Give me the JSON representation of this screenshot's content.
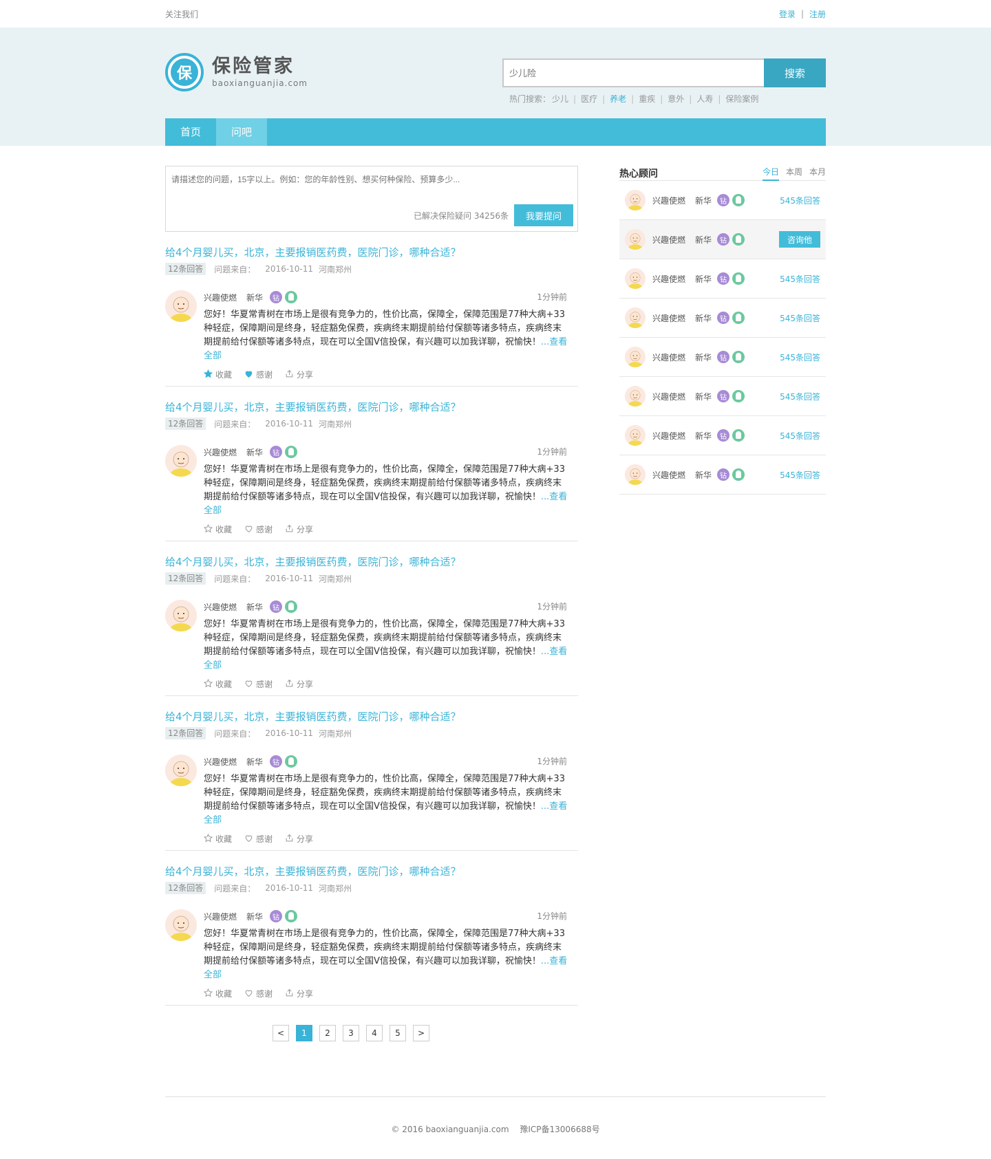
{
  "topbar": {
    "follow": "关注我们",
    "login": "登录",
    "register": "注册"
  },
  "logo": {
    "cn": "保险管家",
    "en": "baoxianguanjia.com",
    "mark": "保"
  },
  "search": {
    "placeholder": "少儿险",
    "button": "搜索",
    "hot_label": "热门搜索：",
    "hot_items": [
      "少儿",
      "医疗",
      "养老",
      "重疾",
      "意外",
      "人寿",
      "保险案例"
    ]
  },
  "nav": [
    "首页",
    "问吧"
  ],
  "ask": {
    "placeholder": "请描述您的问题，15字以上。例如：您的年龄性别、想买何种保险、预算多少...",
    "solved": "已解决保险疑问  34256条",
    "button": "我要提问"
  },
  "questions": [
    {
      "title": "给4个月婴儿买，北京，主要报销医药费，医院门诊，哪种合适？",
      "count": "12条回答",
      "from": "问题来自：",
      "date": "2016-10-11",
      "place": "河南郑州",
      "user": "兴趣使燃",
      "company": "新华",
      "vbadge": "钻",
      "time": "1分钟前",
      "text": "您好！华夏常青树在市场上是很有竞争力的，性价比高，保障全，保障范围是77种大病+33种轻症，保障期间是终身，轻症豁免保费，疾病终末期提前给付保额等诸多特点，疾病终末期提前给付保额等诸多特点，现在可以全国V信投保，有兴趣可以加我详聊，祝愉快！",
      "more": "...查看全部",
      "collect": "收藏",
      "thanks": "感谢",
      "share": "分享",
      "filled": true
    },
    {
      "title": "给4个月婴儿买，北京，主要报销医药费，医院门诊，哪种合适？",
      "count": "12条回答",
      "from": "问题来自：",
      "date": "2016-10-11",
      "place": "河南郑州",
      "user": "兴趣使燃",
      "company": "新华",
      "vbadge": "钻",
      "time": "1分钟前",
      "text": "您好！华夏常青树在市场上是很有竞争力的，性价比高，保障全，保障范围是77种大病+33种轻症，保障期间是终身，轻症豁免保费，疾病终末期提前给付保额等诸多特点，疾病终末期提前给付保额等诸多特点，现在可以全国V信投保，有兴趣可以加我详聊，祝愉快！",
      "more": "...查看全部",
      "collect": "收藏",
      "thanks": "感谢",
      "share": "分享",
      "filled": false
    },
    {
      "title": "给4个月婴儿买，北京，主要报销医药费，医院门诊，哪种合适？",
      "count": "12条回答",
      "from": "问题来自：",
      "date": "2016-10-11",
      "place": "河南郑州",
      "user": "兴趣使燃",
      "company": "新华",
      "vbadge": "钻",
      "time": "1分钟前",
      "text": "您好！华夏常青树在市场上是很有竞争力的，性价比高，保障全，保障范围是77种大病+33种轻症，保障期间是终身，轻症豁免保费，疾病终末期提前给付保额等诸多特点，疾病终末期提前给付保额等诸多特点，现在可以全国V信投保，有兴趣可以加我详聊，祝愉快！",
      "more": "...查看全部",
      "collect": "收藏",
      "thanks": "感谢",
      "share": "分享",
      "filled": false
    },
    {
      "title": "给4个月婴儿买，北京，主要报销医药费，医院门诊，哪种合适？",
      "count": "12条回答",
      "from": "问题来自：",
      "date": "2016-10-11",
      "place": "河南郑州",
      "user": "兴趣使燃",
      "company": "新华",
      "vbadge": "钻",
      "time": "1分钟前",
      "text": "您好！华夏常青树在市场上是很有竞争力的，性价比高，保障全，保障范围是77种大病+33种轻症，保障期间是终身，轻症豁免保费，疾病终末期提前给付保额等诸多特点，疾病终末期提前给付保额等诸多特点，现在可以全国V信投保，有兴趣可以加我详聊，祝愉快！",
      "more": "...查看全部",
      "collect": "收藏",
      "thanks": "感谢",
      "share": "分享",
      "filled": false
    },
    {
      "title": "给4个月婴儿买，北京，主要报销医药费，医院门诊，哪种合适？",
      "count": "12条回答",
      "from": "问题来自：",
      "date": "2016-10-11",
      "place": "河南郑州",
      "user": "兴趣使燃",
      "company": "新华",
      "vbadge": "钻",
      "time": "1分钟前",
      "text": "您好！华夏常青树在市场上是很有竞争力的，性价比高，保障全，保障范围是77种大病+33种轻症，保障期间是终身，轻症豁免保费，疾病终末期提前给付保额等诸多特点，疾病终末期提前给付保额等诸多特点，现在可以全国V信投保，有兴趣可以加我详聊，祝愉快！",
      "more": "...查看全部",
      "collect": "收藏",
      "thanks": "感谢",
      "share": "分享",
      "filled": false
    }
  ],
  "pager": [
    "<",
    "1",
    "2",
    "3",
    "4",
    "5",
    ">"
  ],
  "pager_active": "1",
  "advisors": {
    "title": "热心顾问",
    "tabs": [
      "今日",
      "本周",
      "本月"
    ],
    "items": [
      {
        "name": "兴趣使燃",
        "company": "新华",
        "vbadge": "钻",
        "count": "545条回答",
        "consult": false
      },
      {
        "name": "兴趣使燃",
        "company": "新华",
        "vbadge": "钻",
        "count": "咨询他",
        "consult": true
      },
      {
        "name": "兴趣使燃",
        "company": "新华",
        "vbadge": "钻",
        "count": "545条回答",
        "consult": false
      },
      {
        "name": "兴趣使燃",
        "company": "新华",
        "vbadge": "钻",
        "count": "545条回答",
        "consult": false
      },
      {
        "name": "兴趣使燃",
        "company": "新华",
        "vbadge": "钻",
        "count": "545条回答",
        "consult": false
      },
      {
        "name": "兴趣使燃",
        "company": "新华",
        "vbadge": "钻",
        "count": "545条回答",
        "consult": false
      },
      {
        "name": "兴趣使燃",
        "company": "新华",
        "vbadge": "钻",
        "count": "545条回答",
        "consult": false
      },
      {
        "name": "兴趣使燃",
        "company": "新华",
        "vbadge": "钻",
        "count": "545条回答",
        "consult": false
      }
    ]
  },
  "footer": {
    "copyright": "© 2016 baoxianguanjia.com",
    "icp": "豫ICP备13006688号"
  },
  "colors": {
    "accent": "#39b3d7",
    "nav": "#43bcd9",
    "header_bg": "#e8f2f5"
  }
}
